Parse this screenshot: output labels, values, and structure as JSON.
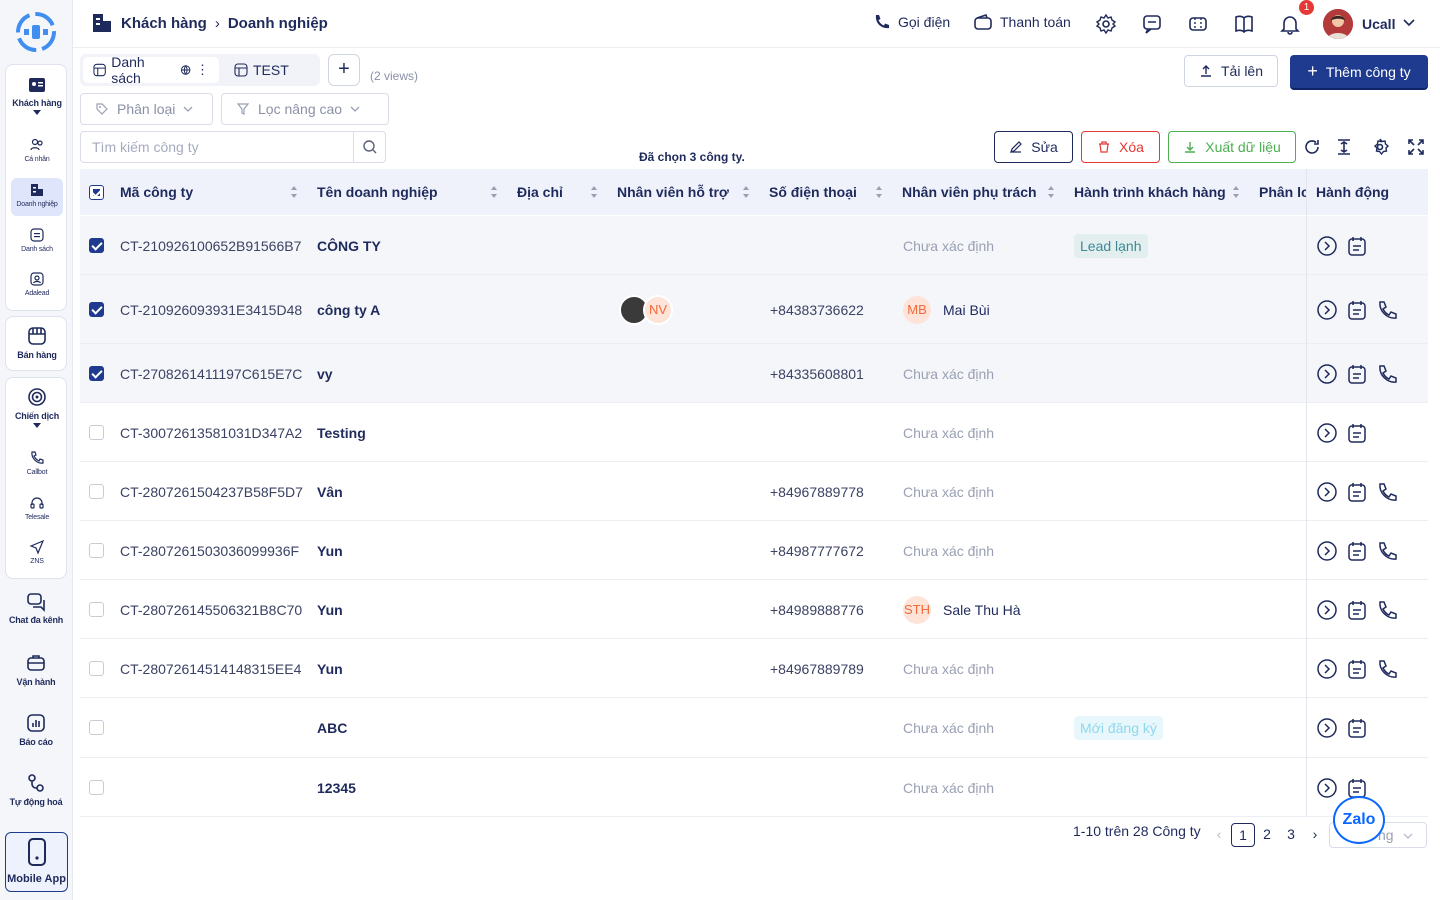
{
  "header": {
    "breadcrumb": [
      "Khách hàng",
      "Doanh nghiệp"
    ],
    "call_label": "Gọi điện",
    "payment_label": "Thanh toán",
    "notification_count": "1",
    "user_name": "Ucall"
  },
  "sidebar": {
    "groups": [
      {
        "label": "Khách hàng",
        "children": [
          "Cá nhân",
          "Doanh nghiệp",
          "Danh sách",
          "Adalead"
        ]
      },
      {
        "label": "Bán hàng"
      },
      {
        "label": "Chiến dịch",
        "children": [
          "Callbot",
          "Telesale",
          "ZNS"
        ]
      },
      {
        "label": "Chat đa kênh"
      },
      {
        "label": "Vận hành"
      },
      {
        "label": "Báo cáo"
      },
      {
        "label": "Tự động hoá"
      }
    ],
    "mobile_app": "Mobile App"
  },
  "toolbar": {
    "tabs": [
      "Danh sách",
      "TEST"
    ],
    "views_count": "(2 views)",
    "upload_label": "Tải lên",
    "add_company_label": "Thêm công ty",
    "filter_category": "Phân loại",
    "filter_advanced": "Lọc nâng cao",
    "search_placeholder": "Tìm kiếm công ty",
    "selected_info": "Đã chọn 3 công ty.",
    "edit_label": "Sửa",
    "delete_label": "Xóa",
    "export_label": "Xuất dữ liệu"
  },
  "table": {
    "columns": [
      "Mã công ty",
      "Tên doanh nghiệp",
      "Địa chỉ",
      "Nhân viên hỗ trợ",
      "Số điện thoại",
      "Nhân viên phụ trách",
      "Hành trình khách hàng",
      "Phân lo",
      "Hành động"
    ],
    "rows": [
      {
        "selected": true,
        "code": "CT-210926100652B91566B7",
        "name": "CÔNG TY",
        "phone": "",
        "owner": "Chưa xác định",
        "owner_initials": "",
        "journey": "Lead lạnh",
        "support": "",
        "call": false
      },
      {
        "selected": true,
        "code": "CT-210926093931E3415D48",
        "name": "công ty A",
        "phone": "+84383736622",
        "owner": "Mai Bùi",
        "owner_initials": "MB",
        "journey": "",
        "support": "NV",
        "call": true
      },
      {
        "selected": true,
        "code": "CT-2708261411197C615E7C",
        "name": "vy",
        "phone": "+84335608801",
        "owner": "Chưa xác định",
        "owner_initials": "",
        "journey": "",
        "support": "",
        "call": true
      },
      {
        "selected": false,
        "code": "CT-30072613581031D347A2",
        "name": "Testing",
        "phone": "",
        "owner": "Chưa xác định",
        "owner_initials": "",
        "journey": "",
        "support": "",
        "call": false
      },
      {
        "selected": false,
        "code": "CT-2807261504237B58F5D7",
        "name": "Vân",
        "phone": "+84967889778",
        "owner": "Chưa xác định",
        "owner_initials": "",
        "journey": "",
        "support": "",
        "call": true
      },
      {
        "selected": false,
        "code": "CT-2807261503036099936F",
        "name": "Yun",
        "phone": "+84987777672",
        "owner": "Chưa xác định",
        "owner_initials": "",
        "journey": "",
        "support": "",
        "call": true
      },
      {
        "selected": false,
        "code": "CT-280726145506321B8C70",
        "name": "Yun",
        "phone": "+84989888776",
        "owner": "Sale Thu Hà",
        "owner_initials": "STH",
        "journey": "",
        "support": "",
        "call": true
      },
      {
        "selected": false,
        "code": "CT-28072614514148315EE4",
        "name": "Yun",
        "phone": "+84967889789",
        "owner": "Chưa xác định",
        "owner_initials": "",
        "journey": "",
        "support": "",
        "call": true
      },
      {
        "selected": false,
        "code": "",
        "name": "ABC",
        "phone": "",
        "owner": "Chưa xác định",
        "owner_initials": "",
        "journey": "Mới đăng ký",
        "support": "",
        "call": false
      },
      {
        "selected": false,
        "code": "",
        "name": "12345",
        "phone": "",
        "owner": "Chưa xác định",
        "owner_initials": "",
        "journey": "",
        "support": "",
        "call": false
      }
    ]
  },
  "footer": {
    "summary": "1-10 trên 28 Công ty",
    "pages": [
      "1",
      "2",
      "3"
    ],
    "current_page": "1",
    "page_size_label": "ng",
    "zalo_label": "Zalo"
  },
  "colors": {
    "primary": "#1f3b8f",
    "danger": "#e53935",
    "success": "#4caf50",
    "journey_cold": "#e3efef",
    "journey_new": "#e8f7fb"
  }
}
